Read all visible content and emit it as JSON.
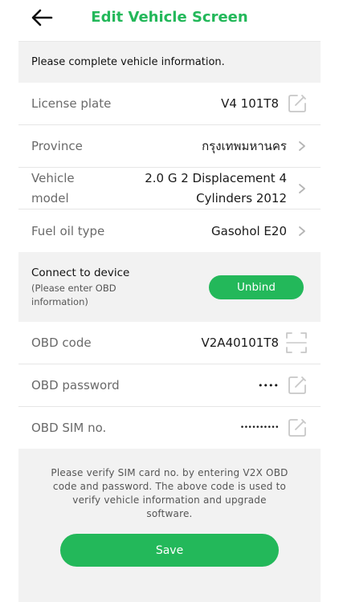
{
  "header": {
    "title": "Edit Vehicle Screen"
  },
  "notice": "Please complete vehicle information.",
  "vehicle": {
    "license_plate": {
      "label": "License plate",
      "value": "V4 101T8"
    },
    "province": {
      "label": "Province",
      "value": "กรุงเทพมหานคร"
    },
    "model": {
      "label_line1": "Vehicle",
      "label_line2": "model",
      "value_line1": "2.0 G 2 Displacement 4",
      "value_line2": "Cylinders 2012"
    },
    "fuel": {
      "label": "Fuel oil type",
      "value": "Gasohol E20"
    }
  },
  "device": {
    "title": "Connect to device",
    "subtitle": "(Please enter OBD information)",
    "unbind_label": "Unbind"
  },
  "obd": {
    "code": {
      "label": "OBD code",
      "value": "V2A40101T8"
    },
    "password": {
      "label": "OBD password",
      "value": "••••"
    },
    "sim": {
      "label": "OBD SIM no.",
      "value": "••••••••••"
    }
  },
  "footer": {
    "note": "Please verify SIM card no. by entering V2X OBD code and password. The above code is used to verify vehicle information and upgrade software.",
    "save_label": "Save"
  },
  "colors": {
    "accent": "#23b85a",
    "panel": "#f2f2f2",
    "label": "#6a6a6a",
    "icon": "#c8c8c8"
  },
  "icons": {
    "back": "arrow-left-icon",
    "edit": "edit-icon",
    "chevron": "chevron-right-icon",
    "scan": "scan-icon"
  }
}
